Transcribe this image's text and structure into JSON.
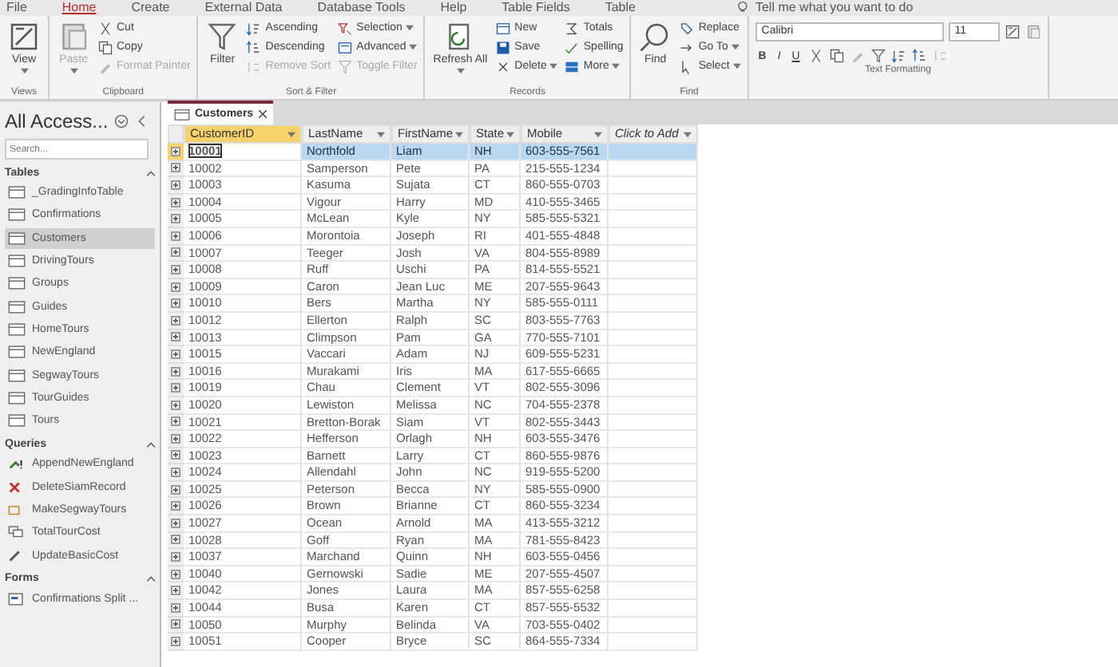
{
  "menu_tabs": [
    {
      "label": "File",
      "selected": false
    },
    {
      "label": "Home",
      "selected": true
    },
    {
      "label": "Create",
      "selected": false
    },
    {
      "label": "External Data",
      "selected": false
    },
    {
      "label": "Database Tools",
      "selected": false
    },
    {
      "label": "Help",
      "selected": false
    },
    {
      "label": "Table Fields",
      "selected": false
    },
    {
      "label": "Table",
      "selected": false
    }
  ],
  "tell_me": "Tell me what you want to do",
  "ribbon": {
    "groups": [
      {
        "label": "Views",
        "items": [
          {
            "kind": "large",
            "label": "View",
            "disabled": false,
            "dropdown": true
          }
        ]
      },
      {
        "label": "Clipboard",
        "items": [
          {
            "kind": "large",
            "label": "Paste",
            "disabled": true,
            "dropdown": true
          },
          {
            "kind": "small",
            "label": "Cut",
            "disabled": false,
            "dropdown": false
          },
          {
            "kind": "small",
            "label": "Copy",
            "disabled": false,
            "dropdown": false
          },
          {
            "kind": "small",
            "label": "Format Painter",
            "disabled": true,
            "dropdown": false
          }
        ]
      },
      {
        "label": "Sort & Filter",
        "items": [
          {
            "kind": "large",
            "label": "Filter",
            "disabled": false,
            "dropdown": false
          },
          {
            "kind": "small",
            "label": "Ascending",
            "disabled": false,
            "dropdown": false
          },
          {
            "kind": "small",
            "label": "Descending",
            "disabled": false,
            "dropdown": false
          },
          {
            "kind": "small",
            "label": "Remove Sort",
            "disabled": true,
            "dropdown": false
          },
          {
            "kind": "small",
            "label": "Selection",
            "disabled": false,
            "dropdown": true
          },
          {
            "kind": "small",
            "label": "Advanced",
            "disabled": false,
            "dropdown": true
          },
          {
            "kind": "small",
            "label": "Toggle Filter",
            "disabled": true,
            "dropdown": false
          }
        ]
      },
      {
        "label": "Records",
        "items": [
          {
            "kind": "large",
            "label": "Refresh All",
            "disabled": false,
            "dropdown": true
          },
          {
            "kind": "small",
            "label": "New",
            "disabled": false,
            "dropdown": false
          },
          {
            "kind": "small",
            "label": "Save",
            "disabled": false,
            "dropdown": false
          },
          {
            "kind": "small",
            "label": "Delete",
            "disabled": false,
            "dropdown": true
          },
          {
            "kind": "small",
            "label": "Totals",
            "disabled": false,
            "dropdown": false
          },
          {
            "kind": "small",
            "label": "Spelling",
            "disabled": false,
            "dropdown": false
          },
          {
            "kind": "small",
            "label": "More",
            "disabled": false,
            "dropdown": true
          }
        ]
      },
      {
        "label": "Find",
        "items": [
          {
            "kind": "large",
            "label": "Find",
            "disabled": false,
            "dropdown": false
          },
          {
            "kind": "small",
            "label": "Replace",
            "disabled": false,
            "dropdown": false
          },
          {
            "kind": "small",
            "label": "Go To",
            "disabled": false,
            "dropdown": true
          },
          {
            "kind": "small",
            "label": "Select",
            "disabled": false,
            "dropdown": true
          }
        ]
      },
      {
        "label": "Text Formatting",
        "font": "Calibri",
        "size": "11",
        "styles": [
          "B",
          "I",
          "U"
        ]
      }
    ]
  },
  "nav": {
    "title": "All Access...",
    "search_placeholder": "Search...",
    "sections": [
      {
        "title": "Tables",
        "expanded": true,
        "items": [
          {
            "label": "_GradingInfoTable",
            "kind": "table",
            "selected": false
          },
          {
            "label": "Confirmations",
            "kind": "table",
            "selected": false
          },
          {
            "label": "Customers",
            "kind": "table",
            "selected": true
          },
          {
            "label": "DrivingTours",
            "kind": "table",
            "selected": false
          },
          {
            "label": "Groups",
            "kind": "table",
            "selected": false
          },
          {
            "label": "Guides",
            "kind": "table",
            "selected": false
          },
          {
            "label": "HomeTours",
            "kind": "table",
            "selected": false
          },
          {
            "label": "NewEngland",
            "kind": "table",
            "selected": false
          },
          {
            "label": "SegwayTours",
            "kind": "table",
            "selected": false
          },
          {
            "label": "TourGuides",
            "kind": "table",
            "selected": false
          },
          {
            "label": "Tours",
            "kind": "table",
            "selected": false
          }
        ]
      },
      {
        "title": "Queries",
        "expanded": true,
        "items": [
          {
            "label": "AppendNewEngland",
            "kind": "append",
            "selected": false
          },
          {
            "label": "DeleteSiamRecord",
            "kind": "delete",
            "selected": false
          },
          {
            "label": "MakeSegwayTours",
            "kind": "make",
            "selected": false
          },
          {
            "label": "TotalTourCost",
            "kind": "crosstab",
            "selected": false
          },
          {
            "label": "UpdateBasicCost",
            "kind": "update",
            "selected": false
          }
        ]
      },
      {
        "title": "Forms",
        "expanded": true,
        "items": [
          {
            "label": "Confirmations Split ...",
            "kind": "form",
            "selected": false
          }
        ]
      }
    ]
  },
  "table": {
    "tab": "Customers",
    "columns": [
      "CustomerID",
      "LastName",
      "FirstName",
      "State",
      "Mobile",
      "Click to Add"
    ],
    "rows": [
      {
        "cells": [
          "10001",
          "Northfold",
          "Liam",
          "NH",
          "603-555-7561",
          ""
        ],
        "selected": true
      },
      {
        "cells": [
          "10002",
          "Samperson",
          "Pete",
          "PA",
          "215-555-1234",
          ""
        ],
        "selected": false
      },
      {
        "cells": [
          "10003",
          "Kasuma",
          "Sujata",
          "CT",
          "860-555-0703",
          ""
        ],
        "selected": false
      },
      {
        "cells": [
          "10004",
          "Vigour",
          "Harry",
          "MD",
          "410-555-3465",
          ""
        ],
        "selected": false
      },
      {
        "cells": [
          "10005",
          "McLean",
          "Kyle",
          "NY",
          "585-555-5321",
          ""
        ],
        "selected": false
      },
      {
        "cells": [
          "10006",
          "Morontoia",
          "Joseph",
          "RI",
          "401-555-4848",
          ""
        ],
        "selected": false
      },
      {
        "cells": [
          "10007",
          "Teeger",
          "Josh",
          "VA",
          "804-555-8989",
          ""
        ],
        "selected": false
      },
      {
        "cells": [
          "10008",
          "Ruff",
          "Uschi",
          "PA",
          "814-555-5521",
          ""
        ],
        "selected": false
      },
      {
        "cells": [
          "10009",
          "Caron",
          "Jean Luc",
          "ME",
          "207-555-9643",
          ""
        ],
        "selected": false
      },
      {
        "cells": [
          "10010",
          "Bers",
          "Martha",
          "NY",
          "585-555-0111",
          ""
        ],
        "selected": false
      },
      {
        "cells": [
          "10012",
          "Ellerton",
          "Ralph",
          "SC",
          "803-555-7763",
          ""
        ],
        "selected": false
      },
      {
        "cells": [
          "10013",
          "Climpson",
          "Pam",
          "GA",
          "770-555-7101",
          ""
        ],
        "selected": false
      },
      {
        "cells": [
          "10015",
          "Vaccari",
          "Adam",
          "NJ",
          "609-555-5231",
          ""
        ],
        "selected": false
      },
      {
        "cells": [
          "10016",
          "Murakami",
          "Iris",
          "MA",
          "617-555-6665",
          ""
        ],
        "selected": false
      },
      {
        "cells": [
          "10019",
          "Chau",
          "Clement",
          "VT",
          "802-555-3096",
          ""
        ],
        "selected": false
      },
      {
        "cells": [
          "10020",
          "Lewiston",
          "Melissa",
          "NC",
          "704-555-2378",
          ""
        ],
        "selected": false
      },
      {
        "cells": [
          "10021",
          "Bretton-Borak",
          "Siam",
          "VT",
          "802-555-3443",
          ""
        ],
        "selected": false
      },
      {
        "cells": [
          "10022",
          "Hefferson",
          "Orlagh",
          "NH",
          "603-555-3476",
          ""
        ],
        "selected": false
      },
      {
        "cells": [
          "10023",
          "Barnett",
          "Larry",
          "CT",
          "860-555-9876",
          ""
        ],
        "selected": false
      },
      {
        "cells": [
          "10024",
          "Allendahl",
          "John",
          "NC",
          "919-555-5200",
          ""
        ],
        "selected": false
      },
      {
        "cells": [
          "10025",
          "Peterson",
          "Becca",
          "NY",
          "585-555-0900",
          ""
        ],
        "selected": false
      },
      {
        "cells": [
          "10026",
          "Brown",
          "Brianne",
          "CT",
          "860-555-3234",
          ""
        ],
        "selected": false
      },
      {
        "cells": [
          "10027",
          "Ocean",
          "Arnold",
          "MA",
          "413-555-3212",
          ""
        ],
        "selected": false
      },
      {
        "cells": [
          "10028",
          "Goff",
          "Ryan",
          "MA",
          "781-555-8423",
          ""
        ],
        "selected": false
      },
      {
        "cells": [
          "10037",
          "Marchand",
          "Quinn",
          "NH",
          "603-555-0456",
          ""
        ],
        "selected": false
      },
      {
        "cells": [
          "10040",
          "Gernowski",
          "Sadie",
          "ME",
          "207-555-4507",
          ""
        ],
        "selected": false
      },
      {
        "cells": [
          "10042",
          "Jones",
          "Laura",
          "MA",
          "857-555-6258",
          ""
        ],
        "selected": false
      },
      {
        "cells": [
          "10044",
          "Busa",
          "Karen",
          "CT",
          "857-555-5532",
          ""
        ],
        "selected": false
      },
      {
        "cells": [
          "10050",
          "Murphy",
          "Belinda",
          "VA",
          "703-555-0402",
          ""
        ],
        "selected": false
      },
      {
        "cells": [
          "10051",
          "Cooper",
          "Bryce",
          "SC",
          "864-555-7334",
          ""
        ],
        "selected": false
      }
    ]
  }
}
